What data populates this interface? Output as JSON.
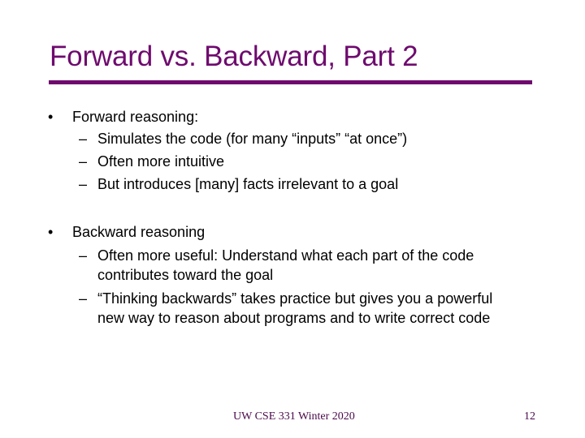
{
  "slide": {
    "title": "Forward vs. Backward, Part 2",
    "accent_color": "#6e0a6e",
    "bullets": [
      {
        "marker": "•",
        "text": "Forward reasoning:",
        "subitems": [
          {
            "marker": "–",
            "text": "Simulates the code (for many “inputs” “at once”)"
          },
          {
            "marker": "–",
            "text": "Often more intuitive"
          },
          {
            "marker": "–",
            "text": "But introduces [many] facts irrelevant to a goal"
          }
        ]
      },
      {
        "marker": "•",
        "text": "Backward reasoning",
        "subitems": [
          {
            "marker": "–",
            "text": "Often more useful: Understand what each part of the code\ncontributes toward the goal"
          },
          {
            "marker": "–",
            "text": "“Thinking backwards” takes practice but gives you a powerful\nnew way to reason about programs and to write correct code"
          }
        ]
      }
    ],
    "footer": {
      "course": "UW CSE 331 Winter 2020",
      "page_number": "12"
    }
  }
}
